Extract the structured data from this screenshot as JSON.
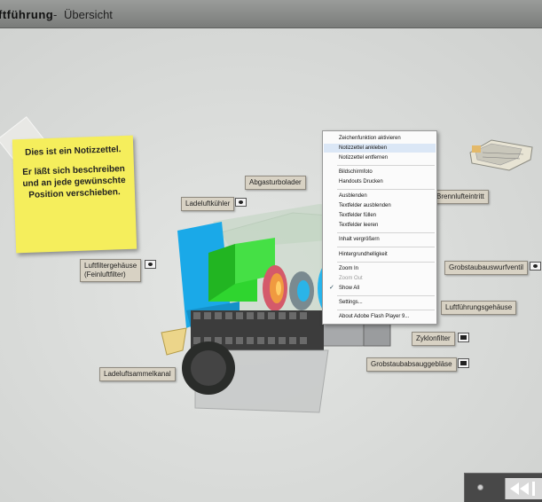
{
  "title": {
    "main": "ftführung",
    "separator": "-",
    "sub": "Übersicht"
  },
  "note": {
    "line1": "Dies ist ein Notizzettel.",
    "line2": "Er läßt sich beschreiben und an jede gewünschte Position verschieben."
  },
  "labels": {
    "abgasturbolader": "Abgasturbolader",
    "ladeluftkuehler": "Ladeluftkühler",
    "luftfiltergehaeuse": "Luftfiltergehäuse",
    "feinluftfilter": "(Feinluftfilter)",
    "ladeluftsammelkanal": "Ladeluftsammelkanal",
    "brennlufteintritt": "Brennlufteintritt",
    "grobstaubauswurfventil": "Grobstaubauswurfventil",
    "luftfuehrungsgehaeuse": "Luftführungsgehäuse",
    "zyklonfilter": "Zyklonfilter",
    "grobstaubabsauggeblaese": "Grobstaubabsauggebläse"
  },
  "context_menu": {
    "items": [
      {
        "label": "Zeichenfunktion aktivieren",
        "state": "normal"
      },
      {
        "label": "Notizzettel ankleben",
        "state": "highlighted"
      },
      {
        "label": "Notizzettel entfernen",
        "state": "normal"
      },
      {
        "label": "Bildschirmfoto",
        "state": "normal"
      },
      {
        "label": "Handouts Drucken",
        "state": "normal"
      },
      {
        "label": "Ausblenden",
        "state": "normal"
      },
      {
        "label": "Textfelder ausblenden",
        "state": "normal"
      },
      {
        "label": "Textfelder füllen",
        "state": "normal"
      },
      {
        "label": "Textfelder leeren",
        "state": "normal"
      },
      {
        "label": "Inhalt vergrößern",
        "state": "normal"
      },
      {
        "label": "Hintergrundhelligkeit",
        "state": "normal"
      },
      {
        "label": "Zoom In",
        "state": "normal"
      },
      {
        "label": "Zoom Out",
        "state": "disabled"
      },
      {
        "label": "Show All",
        "state": "checked"
      },
      {
        "label": "Settings...",
        "state": "normal"
      },
      {
        "label": "About Adobe Flash Player 9...",
        "state": "normal"
      }
    ]
  },
  "icons": {
    "camera": "camera-icon",
    "video": "video-camera-icon",
    "back": "skip-back-icon",
    "indicator": "circle-indicator-icon"
  }
}
